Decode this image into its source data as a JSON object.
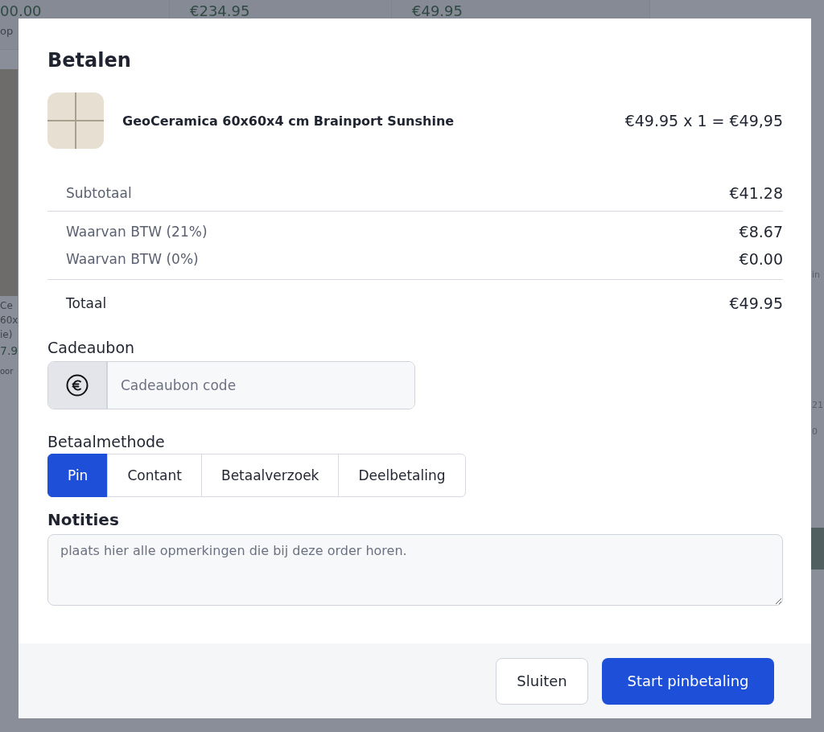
{
  "background": {
    "top_prices": [
      "00.00",
      "€234.95",
      "€49.95"
    ],
    "left_fragments": [
      "Ce",
      "60x",
      "ie)",
      "7.9",
      "oor"
    ],
    "top_left_fragment": "op",
    "right_fragments": [
      "in",
      "21",
      "0"
    ]
  },
  "dialog": {
    "title": "Betalen",
    "product": {
      "name": "GeoCeramica 60x60x4 cm Brainport Sunshine",
      "price_line": "€49.95 x 1 = €49,95"
    },
    "summary": [
      {
        "label": "Subtotaal",
        "value": "€41.28",
        "kind": "subtotal"
      },
      {
        "label": "Waarvan BTW (21%)",
        "value": "€8.67",
        "kind": "tax"
      },
      {
        "label": "Waarvan BTW (0%)",
        "value": "€0.00",
        "kind": "tax"
      },
      {
        "label": "Totaal",
        "value": "€49.95",
        "kind": "total"
      }
    ],
    "gift_card": {
      "label": "Cadeaubon",
      "placeholder": "Cadeaubon code"
    },
    "payment_method": {
      "label": "Betaalmethode",
      "options": [
        {
          "label": "Pin",
          "selected": true
        },
        {
          "label": "Contant",
          "selected": false
        },
        {
          "label": "Betaalverzoek",
          "selected": false
        },
        {
          "label": "Deelbetaling",
          "selected": false
        }
      ]
    },
    "notes": {
      "label": "Notities",
      "placeholder": "plaats hier alle opmerkingen die bij deze order horen."
    },
    "buttons": {
      "close": "Sluiten",
      "primary": "Start pinbetaling"
    }
  }
}
